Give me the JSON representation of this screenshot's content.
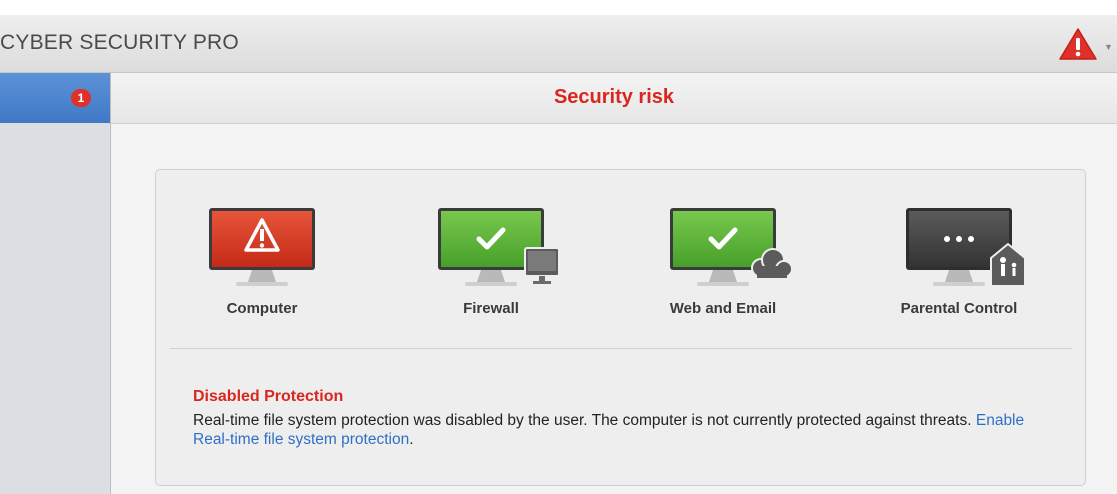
{
  "app": {
    "title": "CYBER SECURITY PRO"
  },
  "sidebar": {
    "items": [
      {
        "badge": "1",
        "icon": "alert-badge"
      }
    ]
  },
  "header": {
    "status": "Security risk"
  },
  "modules": [
    {
      "label": "Computer",
      "state": "alert",
      "icon": "monitor-warning-icon"
    },
    {
      "label": "Firewall",
      "state": "ok",
      "icon": "monitor-check-icon"
    },
    {
      "label": "Web and Email",
      "state": "ok",
      "icon": "monitor-check-cloud-icon"
    },
    {
      "label": "Parental Control",
      "state": "neutral",
      "icon": "monitor-dots-family-icon"
    }
  ],
  "detail": {
    "title": "Disabled Protection",
    "text": "Real-time file system protection was disabled by the user. The computer is not currently protected against threats.",
    "link": "Enable Real-time file system protection",
    "after": "."
  },
  "colors": {
    "alert": "#d9271f",
    "ok": "#4fae2f",
    "neutral": "#444444",
    "accent": "#3f79c6",
    "link": "#2f6fc6"
  }
}
